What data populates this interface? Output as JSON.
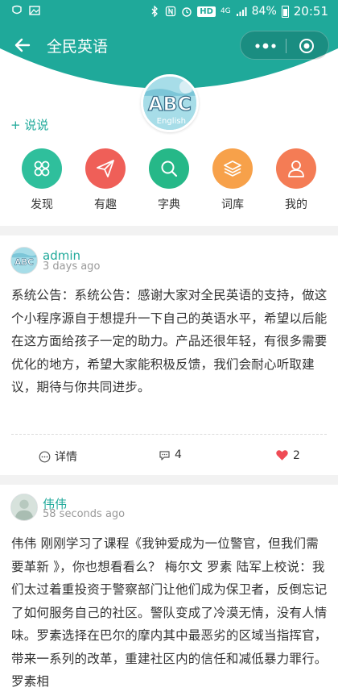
{
  "status_bar": {
    "network": "4G",
    "hd": "HD",
    "battery": "84%",
    "time": "20:51"
  },
  "header": {
    "title": "全民英语",
    "logo_text": "ABC",
    "logo_subtext": "English"
  },
  "say_button": "+ 说说",
  "menu": [
    {
      "label": "发现",
      "icon": "grid-petal-icon",
      "color": "#2fbf9c"
    },
    {
      "label": "有趣",
      "icon": "paper-plane-icon",
      "color": "#ef5f58"
    },
    {
      "label": "字典",
      "icon": "search-icon",
      "color": "#26b888"
    },
    {
      "label": "词库",
      "icon": "layers-icon",
      "color": "#f7a14a"
    },
    {
      "label": "我的",
      "icon": "user-icon",
      "color": "#f47c55"
    }
  ],
  "posts": [
    {
      "user": "admin",
      "time": "3 days ago",
      "text": "系统公告：系统公告：感谢大家对全民英语的支持，做这个小程序源自于想提升一下自己的英语水平，希望以后能在这方面给孩子一定的助力。产品还很年轻，有很多需要优化的地方，希望大家能积极反馈，我们会耐心听取建议，期待与你共同进步。",
      "detail_label": "详情",
      "comments": "4",
      "likes": "2"
    },
    {
      "user": "伟伟",
      "time": "58 seconds ago",
      "text": "伟伟 刚刚学习了课程《我钟爱成为一位警官，但我们需要革新 》，你也想看看么？ 梅尔文 罗素 陆军上校说：我们太过着重投资于警察部门让他们成为保卫者，反倒忘记了如何服务自己的社区。警队变成了冷漠无情，没有人情味。罗素选择在巴尔的摩内其中最恶劣的区域当指挥官，带来一系列的改革，重建社区内的信任和减低暴力罪行。罗素相"
    }
  ]
}
